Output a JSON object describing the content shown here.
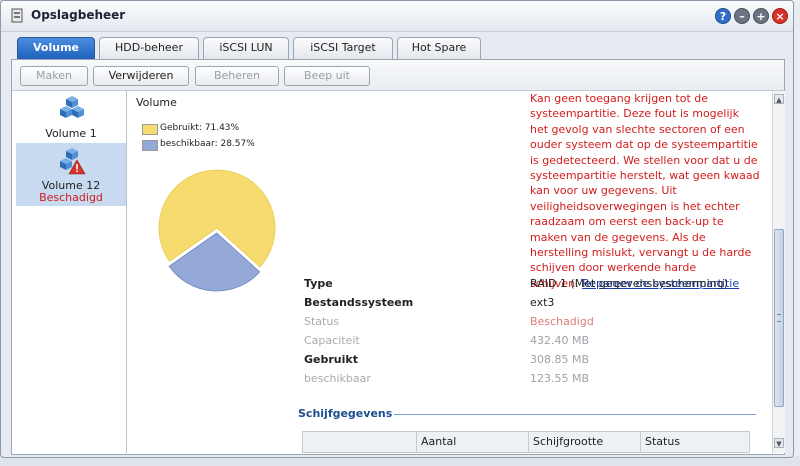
{
  "window": {
    "title": "Opslagbeheer"
  },
  "window_controls": {
    "help": "?",
    "minimize": "–",
    "maximize": "+",
    "close": "×"
  },
  "tabs": [
    {
      "label": "Volume",
      "active": true
    },
    {
      "label": "HDD-beheer"
    },
    {
      "label": "iSCSI LUN"
    },
    {
      "label": "iSCSI Target"
    },
    {
      "label": "Hot Spare"
    }
  ],
  "toolbar": {
    "create": "Maken",
    "delete": "Verwijderen",
    "manage": "Beheren",
    "beep_off": "Beep uit"
  },
  "volumes": [
    {
      "label": "Volume 1",
      "status": ""
    },
    {
      "label": "Volume 12",
      "status": "Beschadigd"
    }
  ],
  "section_title": "Volume",
  "chart_data": {
    "type": "pie",
    "categories": [
      "Gebruikt",
      "beschikbaar"
    ],
    "values": [
      71.43,
      28.57
    ],
    "legend": [
      "Gebruikt: 71.43%",
      "beschikbaar: 28.57%"
    ],
    "colors": [
      "#f6dc6e",
      "#95a9d9"
    ],
    "legend_position": "top-left"
  },
  "error": {
    "message": "Kan geen toegang krijgen tot de systeempartitie. Deze fout is mogelijk het gevolg van slechte sectoren of een ouder systeem dat op de systeempartitie is gedetecteerd. We stellen voor dat u de systeempartitie herstelt, wat geen kwaad kan voor uw gegevens. Uit veiligheidsoverwegingen is het echter raadzaam om eerst een back-up te maken van de gegevens. Als de herstelling mislukt, vervangt u de harde schijven door werkende harde schijven.",
    "lines": [
      "Kan geen toegang krijgen tot de",
      "systeempartitie. Deze fout is mogelijk",
      "het gevolg van slechte sectoren of een",
      "ouder systeem dat op de systeempartitie",
      "is gedetecteerd. We stellen voor dat u de",
      "systeempartitie herstelt, wat geen kwaad",
      "kan voor uw gegevens. Uit",
      "veiligheidsoverwegingen is het echter",
      "raadzaam om eerst een back-up te",
      "maken van de gegevens. Als de",
      "herstelling mislukt, vervangt u de harde",
      "schijven door werkende harde",
      "schijven."
    ],
    "link": "Repareer de systeempartitie"
  },
  "properties": [
    {
      "label": "Type",
      "value": "RAID 1 (Met gegevensbescherming)"
    },
    {
      "label": "Bestandssysteem",
      "value": "ext3"
    },
    {
      "label": "Status",
      "value": "Beschadigd"
    },
    {
      "label": "Capaciteit",
      "value": "432.40 MB"
    },
    {
      "label": "Gebruikt",
      "value": "308.85 MB"
    },
    {
      "label": "beschikbaar",
      "value": "123.55 MB"
    }
  ],
  "disk_section": {
    "title": "Schijfgegevens",
    "columns": [
      "",
      "Aantal",
      "Schijfgrootte",
      "Status"
    ]
  },
  "colors": {
    "accent": "#1d5fb8",
    "error": "#d21d1d",
    "link": "#1a3fb5",
    "used": "#f6dc6e",
    "available": "#95a9d9"
  }
}
